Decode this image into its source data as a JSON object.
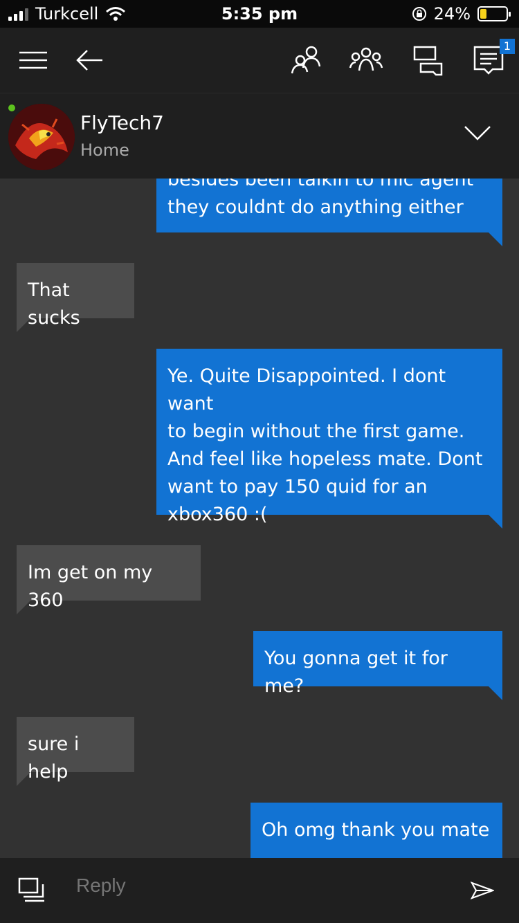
{
  "status_bar": {
    "carrier": "Turkcell",
    "time": "5:35 pm",
    "battery_percent": "24%",
    "battery_level": 0.24,
    "battery_color": "#f7d21b"
  },
  "toolbar": {
    "icons": [
      "menu-icon",
      "back-arrow-icon",
      "friend-icon",
      "party-icon",
      "chat-icon",
      "messages-icon"
    ],
    "messages_badge": "1"
  },
  "conversation": {
    "name": "FlyTech7",
    "status": "Home",
    "online_color": "#5dc21e"
  },
  "messages": [
    {
      "direction": "out",
      "lines": [
        "besides been talkin to mic agent",
        "they couldnt do anything either"
      ]
    },
    {
      "direction": "in",
      "lines": [
        "That sucks"
      ]
    },
    {
      "direction": "out",
      "lines": [
        "Ye. Quite Disappointed. I dont want",
        "to begin without the first game.",
        "And feel like hopeless mate. Dont",
        "want to pay 150 quid for an",
        "xbox360 :("
      ]
    },
    {
      "direction": "in",
      "lines": [
        "Im get on my 360"
      ]
    },
    {
      "direction": "out",
      "lines": [
        "You gonna get it for me?"
      ]
    },
    {
      "direction": "in",
      "lines": [
        "sure i help"
      ]
    },
    {
      "direction": "out",
      "lines": [
        "Oh omg thank you mate"
      ]
    }
  ],
  "reply": {
    "placeholder": "Reply"
  },
  "colors": {
    "outgoing_bubble": "#1273d3",
    "incoming_bubble": "#4c4c4c",
    "background": "#323232"
  }
}
